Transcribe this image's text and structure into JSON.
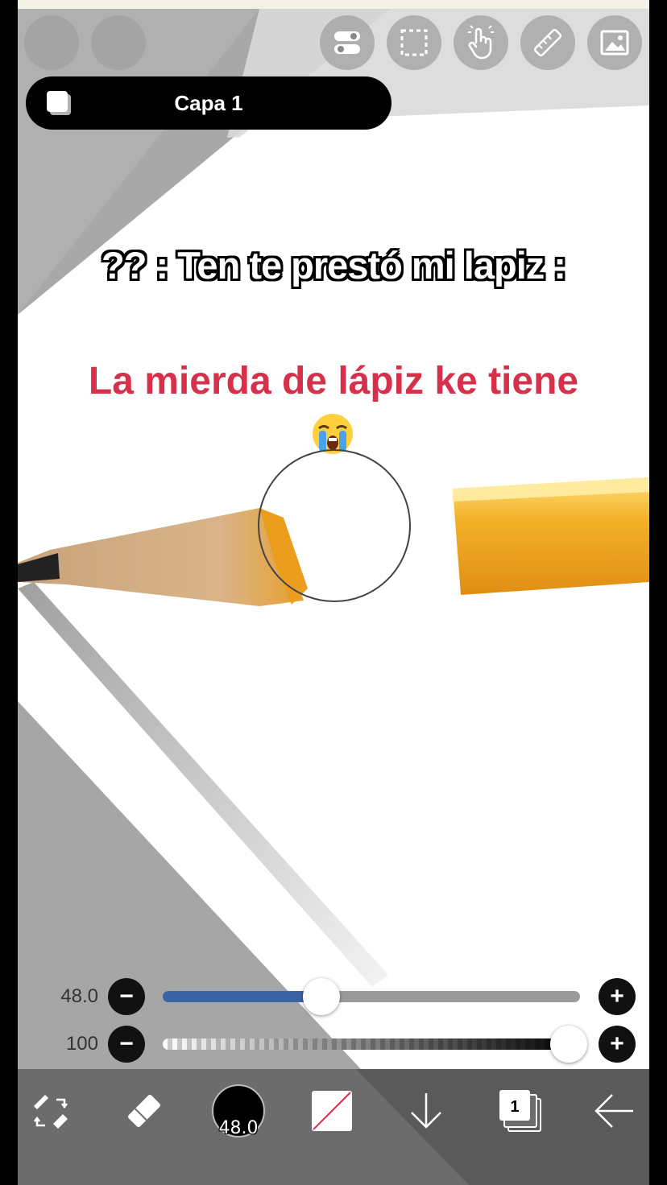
{
  "top_buttons": [
    {
      "icon": "blank-circle-icon"
    },
    {
      "icon": "blank-circle-icon"
    },
    {
      "icon": "toggle-settings-icon"
    },
    {
      "icon": "selection-icon"
    },
    {
      "icon": "hand-touch-icon"
    },
    {
      "icon": "ruler-icon"
    },
    {
      "icon": "image-icon"
    }
  ],
  "layer": {
    "name": "Capa 1"
  },
  "captions": {
    "line1": "?? : Ten te prestó mi lapiz :",
    "line2": "La mierda de lápiz ke tiene",
    "line2_color": "#d6304a"
  },
  "sliders": {
    "size": {
      "value": "48.0",
      "fill_fraction": 0.38,
      "accent": "#3a64a6"
    },
    "opacity": {
      "value": "100",
      "fill_fraction": 1.0
    }
  },
  "toolbar": {
    "brush_size": "48.0",
    "layer_count": "1",
    "items": [
      "swap-tools-icon",
      "eraser-icon",
      "brush-color-icon",
      "secondary-color-icon",
      "arrow-down-icon",
      "layers-icon",
      "arrow-back-icon"
    ]
  },
  "colors": {
    "toolbar_bg": "#6c6c6c",
    "canvas_gray": "#a8a8a8"
  }
}
